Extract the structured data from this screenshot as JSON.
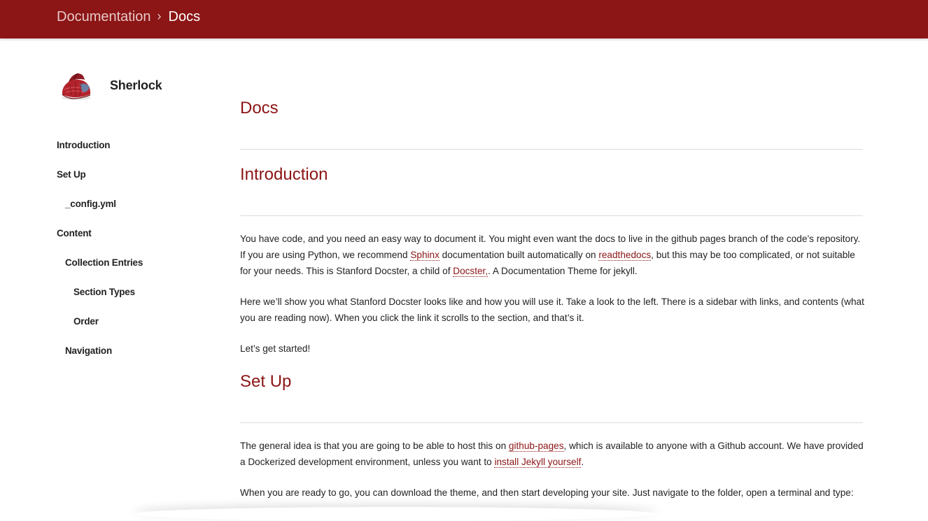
{
  "header": {
    "breadcrumb_parent": "Documentation",
    "breadcrumb_separator": "›",
    "breadcrumb_current": "Docs",
    "color": "#8c1515"
  },
  "sidebar": {
    "brand_name": "Sherlock",
    "logo_icon": "deerstalker-hat-icon",
    "items": [
      {
        "label": "Introduction",
        "level": 0
      },
      {
        "label": "Set Up",
        "level": 0
      },
      {
        "label": "_config.yml",
        "level": 1
      },
      {
        "label": "Content",
        "level": 0
      },
      {
        "label": "Collection Entries",
        "level": 1
      },
      {
        "label": "Section Types",
        "level": 2
      },
      {
        "label": "Order",
        "level": 2
      },
      {
        "label": "Navigation",
        "level": 1
      }
    ]
  },
  "main": {
    "page_title": "Docs",
    "intro": {
      "heading": "Introduction",
      "p1": {
        "t1": "You have code, and you need an easy way to document it. You might even want the docs to live in the github pages branch of the code’s repository. If you are using Python, we recommend ",
        "link1": "Sphinx",
        "t2": " documentation built automatically on ",
        "link2": "readthedocs",
        "t3": ", but this may be too complicated, or not suitable for your needs. This is Stanford Docster, a child of ",
        "link3": "Docster,",
        "t4": ". A Documentation Theme for jekyll."
      },
      "p2": "Here we’ll show you what Stanford Docster looks like and how you will use it. Take a look to the left. There is a sidebar with links, and contents (what you are reading now). When you click the link it scrolls to the section, and that’s it.",
      "p3": "Let’s get started!"
    },
    "setup": {
      "heading": "Set Up",
      "p1": {
        "t1": "The general idea is that you are going to be able to host this on ",
        "link1": "github-pages",
        "t2": ", which is available to anyone with a Github account. We have provided a Dockerized development environment, unless you want to ",
        "link2": "install Jekyll yourself",
        "t3": "."
      },
      "p2": "When you are ready to go, you can download the theme, and then start developing your site. Just navigate to the folder, open a terminal and type:"
    },
    "accent_color": "#8c1515"
  }
}
